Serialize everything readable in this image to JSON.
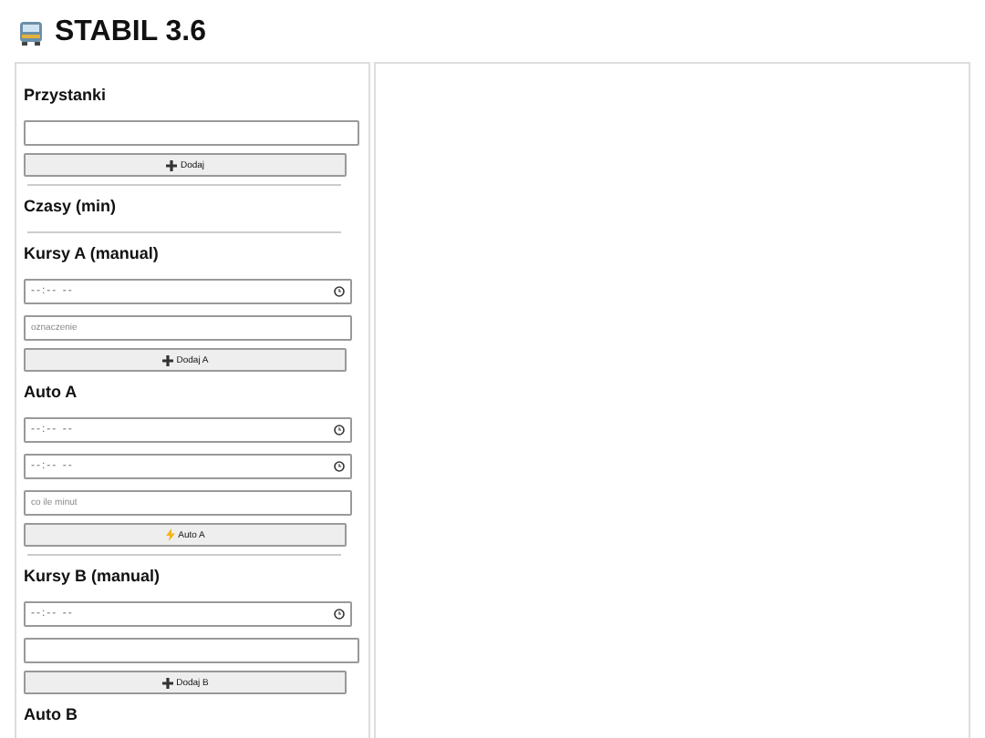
{
  "title": "STABIL 3.6",
  "sidebar": {
    "items": [
      {
        "kind": "heading",
        "text": "Przystanki"
      },
      {
        "kind": "wide-input"
      },
      {
        "kind": "add-button",
        "label": "Dodaj"
      },
      {
        "kind": "divider"
      },
      {
        "kind": "heading",
        "text": "Czasy (min)"
      },
      {
        "kind": "divider"
      },
      {
        "kind": "heading",
        "text": "Kursy A (manual)"
      },
      {
        "kind": "time",
        "placeholder": "--:-- --"
      },
      {
        "kind": "input",
        "placeholder": "oznaczenie"
      },
      {
        "kind": "add-button",
        "label": "Dodaj A"
      },
      {
        "kind": "heading",
        "text": "Auto A"
      },
      {
        "kind": "time",
        "placeholder": "--:-- --"
      },
      {
        "kind": "time",
        "placeholder": "--:-- --"
      },
      {
        "kind": "input",
        "placeholder": "co ile minut"
      },
      {
        "kind": "auto-button",
        "label": "Auto A"
      },
      {
        "kind": "divider"
      },
      {
        "kind": "heading",
        "text": "Kursy B (manual)"
      },
      {
        "kind": "time",
        "placeholder": "--:-- --"
      },
      {
        "kind": "wide-input"
      },
      {
        "kind": "add-button",
        "label": "Dodaj B"
      },
      {
        "kind": "heading",
        "text": "Auto B"
      }
    ]
  }
}
